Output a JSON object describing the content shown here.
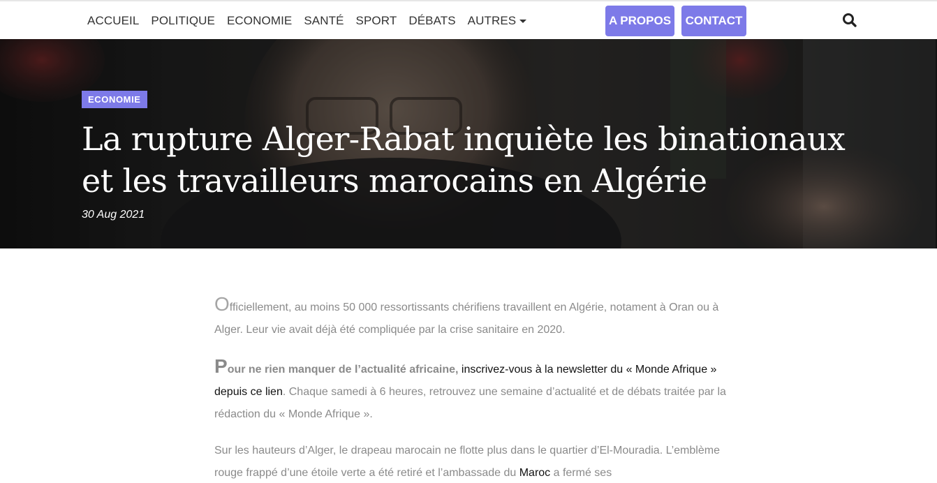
{
  "nav": {
    "items": [
      {
        "label": "ACCUEIL"
      },
      {
        "label": "POLITIQUE"
      },
      {
        "label": "ECONOMIE"
      },
      {
        "label": "SANTÉ"
      },
      {
        "label": "SPORT"
      },
      {
        "label": "DÉBATS"
      },
      {
        "label": "AUTRES"
      }
    ],
    "apropos_label": "A PROPOS",
    "contact_label": "CONTACT",
    "search_icon": "search-icon"
  },
  "colors": {
    "accent": "#7d7ae8",
    "nav_text": "#333333",
    "body_text": "#8a8a8a"
  },
  "hero": {
    "category": "ECONOMIE",
    "title": "La rupture Alger-Rabat inquiète les binationaux et les travailleurs marocains en Algérie",
    "date": "30 Aug 2021"
  },
  "article": {
    "p1": {
      "dropcap": "O",
      "text": "fficiellement, au moins 50 000 ressortissants chérifiens travaillent en Algérie, notament à Oran ou à Alger. Leur vie avait déjà été compliquée par la crise sanitaire en 2020."
    },
    "p2": {
      "dropcap": "P",
      "bold_intro": "our ne rien manquer de l’actualité africaine,",
      "link1": "inscrivez-vous à la newsletter du « Monde Afrique » depuis ce lien",
      "tail": ". Chaque samedi à 6 heures, retrouvez une semaine d’actualité et de débats traitée par la rédaction du « Monde Afrique »."
    },
    "p3": {
      "text_before": "Sur les hauteurs d’Alger, le drapeau marocain ne flotte plus dans le quartier d’El-Mouradia. L’emblème rouge frappé d’une étoile verte a été retiré et l’ambassade du ",
      "link": "Maroc",
      "text_after": " a fermé ses"
    }
  }
}
